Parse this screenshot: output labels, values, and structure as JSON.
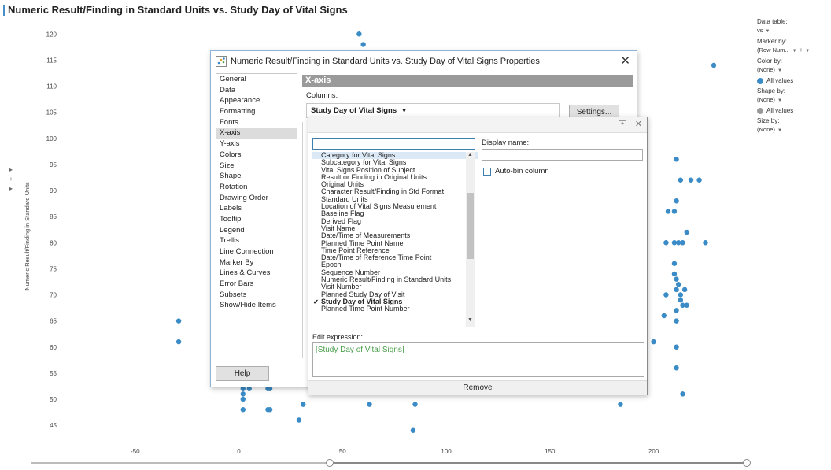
{
  "visualization": {
    "title": "Numeric Result/Finding in Standard Units vs. Study Day of Vital Signs",
    "y_axis_title": "Numeric Result/Finding in Standard Units",
    "left_tools": [
      "▸",
      "+",
      "▸"
    ]
  },
  "chart_data": {
    "type": "scatter",
    "title": "Numeric Result/Finding in Standard Units vs. Study Day of Vital Signs",
    "xlabel": "",
    "ylabel": "Numeric Result/Finding in Standard Units",
    "xlim": [
      -100,
      240
    ],
    "ylim": [
      42,
      122
    ],
    "x_ticks": [
      -50,
      0,
      50,
      100,
      150,
      200
    ],
    "y_ticks": [
      45,
      50,
      55,
      60,
      65,
      70,
      75,
      80,
      85,
      90,
      95,
      100,
      105,
      110,
      115,
      120
    ],
    "grid": false,
    "color": "#3a8bc6",
    "points": [
      {
        "x": 58,
        "y": 120
      },
      {
        "x": 60,
        "y": 118
      },
      {
        "x": 229,
        "y": 114
      },
      {
        "x": -29,
        "y": 65
      },
      {
        "x": -29,
        "y": 61
      },
      {
        "x": 2,
        "y": 52
      },
      {
        "x": 2,
        "y": 51
      },
      {
        "x": 2,
        "y": 50
      },
      {
        "x": 2,
        "y": 48
      },
      {
        "x": 5,
        "y": 52
      },
      {
        "x": 14,
        "y": 52
      },
      {
        "x": 15,
        "y": 52
      },
      {
        "x": 14,
        "y": 48
      },
      {
        "x": 15,
        "y": 48
      },
      {
        "x": 29,
        "y": 46
      },
      {
        "x": 31,
        "y": 49
      },
      {
        "x": 63,
        "y": 49
      },
      {
        "x": 85,
        "y": 49
      },
      {
        "x": 84,
        "y": 44
      },
      {
        "x": 184,
        "y": 49
      },
      {
        "x": 192,
        "y": 88
      },
      {
        "x": 192,
        "y": 81
      },
      {
        "x": 196,
        "y": 60
      },
      {
        "x": 200,
        "y": 61
      },
      {
        "x": 205,
        "y": 66
      },
      {
        "x": 206,
        "y": 70
      },
      {
        "x": 206,
        "y": 80
      },
      {
        "x": 207,
        "y": 86
      },
      {
        "x": 210,
        "y": 86
      },
      {
        "x": 210,
        "y": 80
      },
      {
        "x": 210,
        "y": 76
      },
      {
        "x": 210,
        "y": 74
      },
      {
        "x": 211,
        "y": 96
      },
      {
        "x": 211,
        "y": 88
      },
      {
        "x": 211,
        "y": 73
      },
      {
        "x": 211,
        "y": 71
      },
      {
        "x": 211,
        "y": 67
      },
      {
        "x": 211,
        "y": 65
      },
      {
        "x": 211,
        "y": 60
      },
      {
        "x": 211,
        "y": 56
      },
      {
        "x": 212,
        "y": 80
      },
      {
        "x": 212,
        "y": 72
      },
      {
        "x": 213,
        "y": 70
      },
      {
        "x": 213,
        "y": 69
      },
      {
        "x": 213,
        "y": 92
      },
      {
        "x": 214,
        "y": 80
      },
      {
        "x": 214,
        "y": 68
      },
      {
        "x": 214,
        "y": 51
      },
      {
        "x": 215,
        "y": 71
      },
      {
        "x": 216,
        "y": 68
      },
      {
        "x": 216,
        "y": 82
      },
      {
        "x": 218,
        "y": 92
      },
      {
        "x": 222,
        "y": 92
      },
      {
        "x": 225,
        "y": 80
      }
    ]
  },
  "legend": {
    "data_table_label": "Data table:",
    "data_table_value": "vs",
    "marker_by_label": "Marker by:",
    "marker_by_value": "(Row Num...",
    "color_by_label": "Color by:",
    "color_by_value": "(None)",
    "color_all_values": "All values",
    "color_swatch": "#3a8bc6",
    "shape_by_label": "Shape by:",
    "shape_by_value": "(None)",
    "shape_all_values": "All values",
    "shape_swatch": "#999999",
    "size_by_label": "Size by:",
    "size_by_value": "(None)"
  },
  "properties_dialog": {
    "title": "Numeric Result/Finding in Standard Units vs. Study Day of Vital Signs Properties",
    "close_glyph": "✕",
    "nav_items": [
      "General",
      "Data",
      "Appearance",
      "Formatting",
      "Fonts",
      "X-axis",
      "Y-axis",
      "Colors",
      "Size",
      "Shape",
      "Rotation",
      "Drawing Order",
      "Labels",
      "Tooltip",
      "Legend",
      "Trellis",
      "Line Connection",
      "Marker By",
      "Lines & Curves",
      "Error Bars",
      "Subsets",
      "Show/Hide Items"
    ],
    "active_nav": "X-axis",
    "section_title": "X-axis",
    "columns_label": "Columns:",
    "column_value": "Study Day of Vital Signs",
    "settings_label": "Settings...",
    "help_label": "Help"
  },
  "column_picker": {
    "search_value": "",
    "items": [
      "Category for Vital Signs",
      "Subcategory for Vital Signs",
      "Vital Signs Position of Subject",
      "Result or Finding in Original Units",
      "Original Units",
      "Character Result/Finding in Std Format",
      "Standard Units",
      "Location of Vital Signs Measurement",
      "Baseline Flag",
      "Derived Flag",
      "Visit Name",
      "Date/Time of Measurements",
      "Planned Time Point Name",
      "Time Point Reference",
      "Date/Time of Reference Time Point",
      "Epoch",
      "Sequence Number",
      "Numeric Result/Finding in Standard Units",
      "Visit Number",
      "Planned Study Day of Visit",
      "Study Day of Vital Signs",
      "Planned Time Point Number"
    ],
    "hovered_item": "Category for Vital Signs",
    "selected_item": "Study Day of Vital Signs",
    "display_name_label": "Display name:",
    "display_name_value": "",
    "auto_bin_label": "Auto-bin column",
    "edit_expression_label": "Edit expression:",
    "edit_expression_value": "[Study Day of Vital Signs]",
    "remove_label": "Remove"
  }
}
